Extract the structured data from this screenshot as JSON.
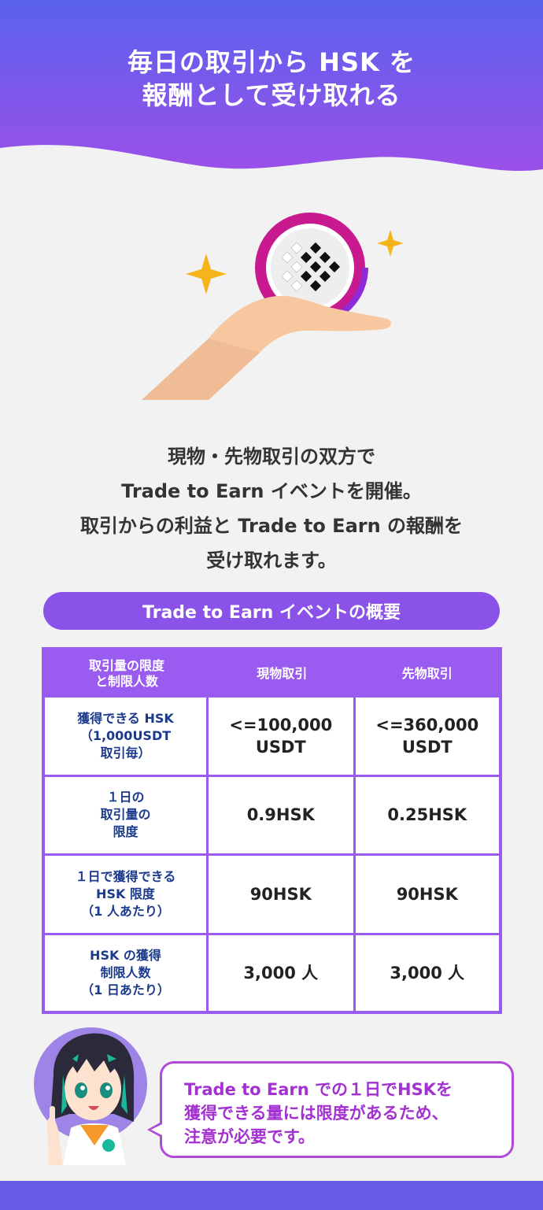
{
  "header": {
    "title_line1": "毎日の取引から HSK を",
    "title_line2": "報酬として受け取れる"
  },
  "intro": {
    "line1": "現物・先物取引の双方で",
    "line2": "Trade to Earn イベントを開催。",
    "line3": "取引からの利益と Trade to Earn の報酬を",
    "line4": "受け取れます。"
  },
  "section": {
    "pill_label": "Trade to Earn イベントの概要"
  },
  "table": {
    "header": {
      "col0_line1": "取引量の限度",
      "col0_line2": "と制限人数",
      "col1": "現物取引",
      "col2": "先物取引"
    },
    "rows": [
      {
        "label_lines": [
          "獲得できる HSK",
          "（1,000USDT",
          "取引毎）"
        ],
        "spot_lines": [
          "<=100,000",
          "USDT"
        ],
        "futures_lines": [
          "<=360,000",
          "USDT"
        ]
      },
      {
        "label_lines": [
          "１日の",
          "取引量の",
          "限度"
        ],
        "spot_lines": [
          "0.9HSK"
        ],
        "futures_lines": [
          "0.25HSK"
        ]
      },
      {
        "label_lines": [
          "１日で獲得できる",
          "HSK 限度",
          "（1 人あたり）"
        ],
        "spot_lines": [
          "90HSK"
        ],
        "futures_lines": [
          "90HSK"
        ]
      },
      {
        "label_lines": [
          "HSK の獲得",
          "制限人数",
          "（1 日あたり）"
        ],
        "spot_lines": [
          "3,000 人"
        ],
        "futures_lines": [
          "3,000 人"
        ]
      }
    ]
  },
  "bubble": {
    "line1": "Trade to Earn での１日でHSKを",
    "line2": "獲得できる量には限度があるため、",
    "line3": "注意が必要です。"
  },
  "colors": {
    "header_gradient_start": "#5a62ee",
    "header_gradient_end": "#9a50e8",
    "accent_purple": "#9a5cf0",
    "table_label_blue": "#1b3a8c",
    "bubble_text": "#a330d0",
    "sparkle": "#f6b41a"
  },
  "icons": {
    "coin": "hashkey-coin-icon",
    "hand": "open-hand-icon",
    "sparkle": "sparkle-icon",
    "avatar": "guide-girl-avatar"
  }
}
